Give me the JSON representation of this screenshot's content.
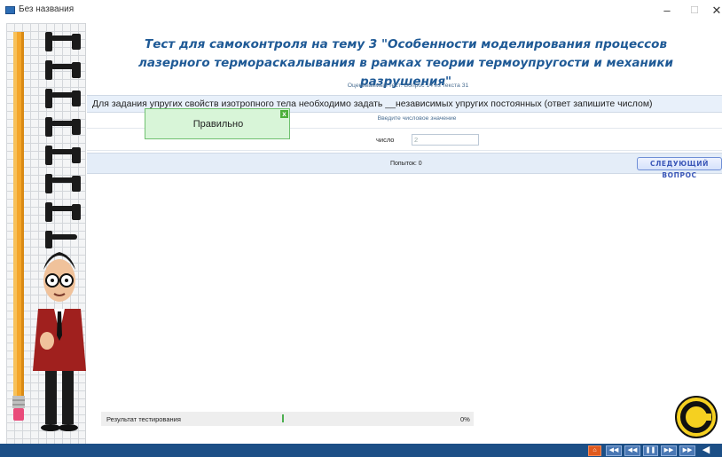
{
  "window": {
    "title": "Без названия",
    "minimize_label": "–",
    "maximize_label": "☐",
    "close_label": "✕"
  },
  "test": {
    "title": "Тест для самоконтроля на тему 3 \"Особенности моделирования процессов лазерного терморaскалывания в рамках теории термоупругости и механики разрушения\"",
    "subtitle": "Оцениваемый тест: Вопрос 14 из текста 31",
    "question": "Для задания упругих свойств изотропного тела необходимо задать __независимых упругих постоянных (ответ запишите числом)",
    "hint": "Введите числовое значение",
    "answer_label": "число",
    "answer_value": "2",
    "attempts": "Попыток: 0",
    "next_button": "СЛЕДУЮЩИЙ ВОПРОС"
  },
  "feedback": {
    "text": "Правильно",
    "close_label": "x"
  },
  "result": {
    "label": "Результат тестирования",
    "percent": "0%",
    "progress": 0
  },
  "player": {
    "home": "⌂",
    "first": "◀◀",
    "prev": "◀◀",
    "pause": "❚❚",
    "next": "▶▶",
    "last": "▶▶",
    "back": "◀"
  },
  "colors": {
    "title": "#1f5a96",
    "bottom_bar": "#1c4f86",
    "feedback_bg": "#d8f5d8",
    "next_button": "#3b57b8"
  }
}
